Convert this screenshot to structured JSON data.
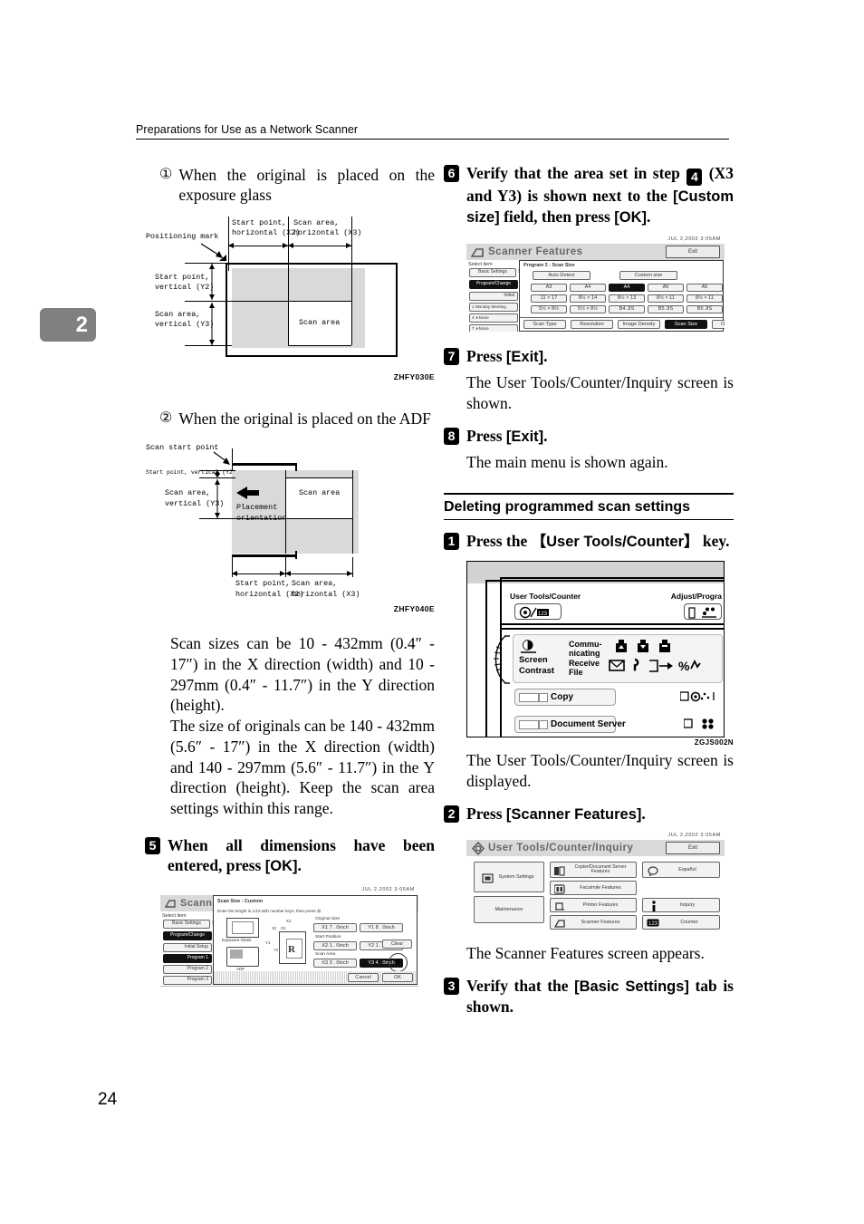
{
  "running_head": "Preparations for Use as a Network Scanner",
  "chapter_tab": "2",
  "page_number": "24",
  "left_column": {
    "item1": {
      "marker": "①",
      "text": "When the original is placed on the exposure glass"
    },
    "figure1": {
      "code": "ZHFY030E",
      "labels": {
        "positioning_mark": "Positioning mark",
        "start_point_horizontal": "Start point,\nhorizontal (X2)",
        "scan_area_horizontal": "Scan area,\nhorizontal (X3)",
        "start_point_vertical": "Start point,\nvertical (Y2)",
        "scan_area_vertical": "Scan area,\nvertical (Y3)",
        "scan_area": "Scan area"
      }
    },
    "item2": {
      "marker": "②",
      "text": "When the original is placed on the ADF"
    },
    "figure2": {
      "code": "ZHFY040E",
      "labels": {
        "scan_start_point": "Scan start point",
        "start_point_vertical": "Start point, vertical (Y2)",
        "scan_area_vertical": "Scan area,\nvertical (Y3)",
        "placement_orientation": "Placement\norientation",
        "scan_area": "Scan area",
        "start_point_horizontal": "Start point,\nhorizontal (X2)",
        "scan_area_horizontal": "Scan area,\nhorizontal (X3)"
      }
    },
    "paragraph1": "Scan sizes can be 10 - 432mm (0.4″ - 17″) in the X direction (width) and 10 - 297mm (0.4″ - 11.7″) in the Y direction (height).",
    "paragraph2": "The size of originals can be 140 - 432mm (5.6″ - 17″) in the X direction (width) and 140 - 297mm (5.6″ - 11.7″) in the Y direction (height). Keep the scan area settings within this range.",
    "step5": {
      "number": "5",
      "text_a": "When all dimensions have been entered, press ",
      "ui": "[OK]",
      "text_b": "."
    },
    "shot_custom_size": {
      "status": "JUL  2,2002  3:05AM",
      "title": "Scanner F",
      "select_item": "Select item",
      "tab_basic": "Basic Settings",
      "tab_partial": "S",
      "side_buttons": [
        "Program/Change",
        "Initial Setup",
        "Program 1",
        "Program 2",
        "Program 3"
      ],
      "dialog_title": "Scan Size : Custom",
      "instruction": "Enter the length in 1/10 with number keys, then press @.",
      "icon_label_glass": "Exposure Glass",
      "icon_label_adf": "ADF",
      "groups": [
        {
          "label": "Original Size",
          "fields": [
            {
              "tag": "X1",
              "value": "7 . 0",
              "unit": "inch",
              "selected": false
            },
            {
              "tag": "Y1",
              "value": "8 . 0",
              "unit": "inch",
              "selected": false
            }
          ]
        },
        {
          "label": "Start Position",
          "fields": [
            {
              "tag": "X2",
              "value": "1 . 0",
              "unit": "inch",
              "selected": false
            },
            {
              "tag": "Y2",
              "value": "1 . 0",
              "unit": "inch",
              "selected": false
            }
          ]
        },
        {
          "label": "Scan Area",
          "fields": [
            {
              "tag": "X3",
              "value": "3 . 0",
              "unit": "inch",
              "selected": false
            },
            {
              "tag": "Y3",
              "value": "4 . 0",
              "unit": "inch",
              "selected": true
            }
          ]
        }
      ],
      "clear_button": "Clear",
      "hash_button": "#",
      "cancel_button": "Cancel",
      "ok_button": "OK",
      "diagram_tags": [
        "X1",
        "X2",
        "X3",
        "Y1",
        "Y2",
        "R"
      ]
    }
  },
  "right_column": {
    "step6": {
      "number": "6",
      "text_a": "Verify that the area set in step ",
      "inline_step": "4",
      "text_b": " (X3 and Y3) is shown next to the ",
      "ui1": "[Custom size]",
      "text_c": " field, then press ",
      "ui2": "[OK]",
      "text_d": "."
    },
    "shot_scanner_features": {
      "status": "JUL  2,2002  3:05AM",
      "title": "Scanner Features",
      "exit_button": "Exit",
      "select_item": "Select item",
      "tab_basic": "Basic Settings",
      "tab_partial": "S",
      "side_buttons": [
        "Program/Change",
        "Initial",
        "1  Monday  Meeting",
        "4  ∗None",
        "7  ∗None"
      ],
      "dialog_title": "Program 3 : Scan Size",
      "top_buttons": [
        "Auto Detect",
        "Custom size"
      ],
      "size_rows": [
        [
          "A3",
          "A4",
          "A4",
          "A5",
          "A5"
        ],
        [
          "11 × 17",
          "8½ × 14",
          "8½ × 13",
          "8½ × 11",
          "8½ × 11"
        ],
        [
          "5½ × 8½",
          "5½ × 8½",
          "B4 JIS",
          "B5 JIS",
          "B5 JIS"
        ]
      ],
      "selected_size": "A4",
      "bottom_tabs": [
        "Scan Type",
        "Resolution",
        "Image Density",
        "Scan Size"
      ],
      "selected_bottom_tab": "Scan Size",
      "ok_button": "OK",
      "code": ""
    },
    "step7": {
      "number": "7",
      "text_a": "Press ",
      "ui": "[Exit]",
      "text_b": ".",
      "note": "The User Tools/Counter/Inquiry screen is shown."
    },
    "step8": {
      "number": "8",
      "text_a": "Press ",
      "ui": "[Exit]",
      "text_b": ".",
      "note": "The main menu is shown again."
    },
    "section_heading": "Deleting programmed scan settings",
    "step_d1": {
      "number": "1",
      "text_a": "Press the ",
      "ui": "【User Tools/Counter】",
      "text_b": " key.",
      "note": "The User Tools/Counter/Inquiry screen is displayed."
    },
    "panel_illustration": {
      "code": "ZGJS002N",
      "label_user_tools": "User Tools/Counter",
      "label_adjust": "Adjust/Progra",
      "label_screen_contrast": "Screen\nContrast",
      "label_communicating": "Commu-\nnicating",
      "label_receive_file": "Receive\nFile",
      "label_copy": "Copy",
      "label_document_server": "Document Server"
    },
    "step_d2": {
      "number": "2",
      "text_a": "Press ",
      "ui": "[Scanner Features]",
      "text_b": ".",
      "note": "The Scanner Features screen appears."
    },
    "shot_user_tools": {
      "status": "JUL  2,2002  3:05AM",
      "title": "User Tools/Counter/Inquiry",
      "exit_button": "Exit",
      "buttons": [
        {
          "label": "System Settings",
          "icon": "system-settings-icon"
        },
        {
          "label": "Copier/Document Server\nFeatures",
          "icon": "copier-icon"
        },
        {
          "label": "Español",
          "icon": "language-icon"
        },
        {
          "label": "Facsimile Features",
          "icon": "fax-icon"
        },
        {
          "label": "Maintenance",
          "icon": "maintenance-icon"
        },
        {
          "label": "Printer Features",
          "icon": "printer-icon"
        },
        {
          "label": "Inquiry",
          "icon": "info-icon"
        },
        {
          "label": "Scanner Features",
          "icon": "scanner-icon"
        },
        {
          "label": "Counter",
          "icon": "counter-icon"
        }
      ]
    },
    "step_d3": {
      "number": "3",
      "text_a": "Verify that the ",
      "ui": "[Basic Settings]",
      "text_b": " tab is shown."
    }
  }
}
